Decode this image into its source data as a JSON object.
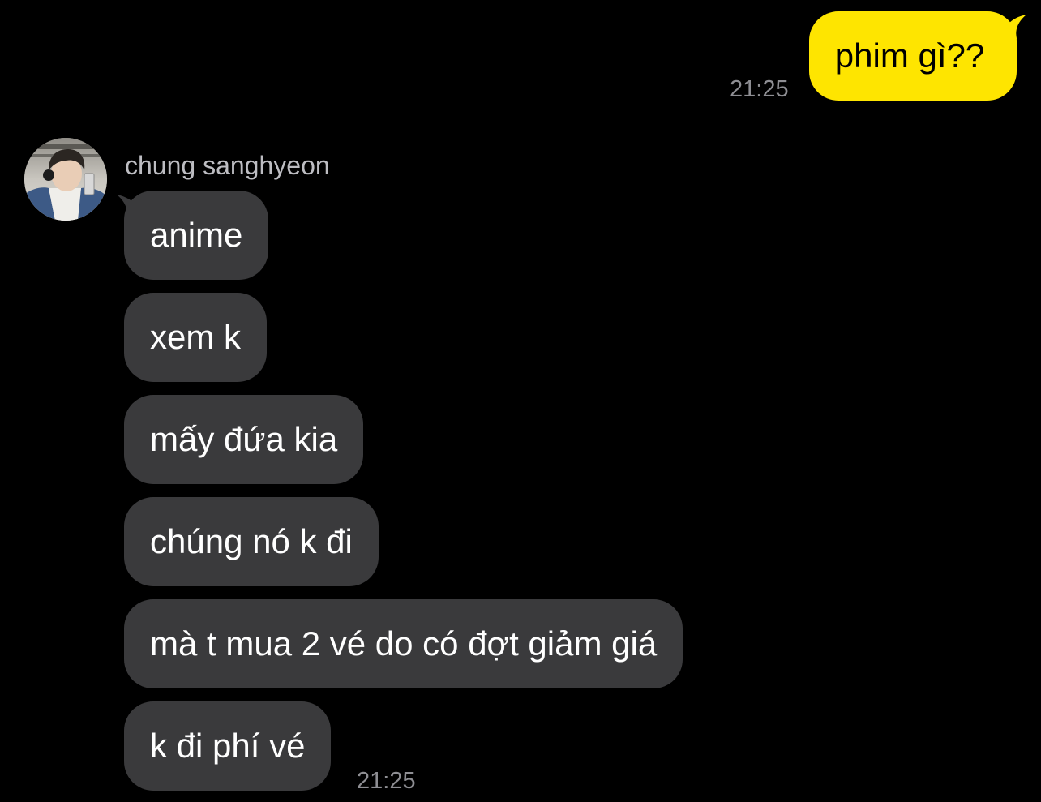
{
  "colors": {
    "background": "#000000",
    "sent_bubble": "#FEE500",
    "received_bubble": "#3A3A3C",
    "timestamp": "#8E8E93"
  },
  "sent": {
    "text": "phim gì??",
    "time": "21:25"
  },
  "received": {
    "sender_name": "chung sanghyeon",
    "avatar_icon": "profile-photo",
    "messages": [
      "anime",
      "xem k",
      "mấy đứa kia",
      "chúng nó k đi",
      "mà t mua 2 vé do có đợt giảm giá",
      "k đi phí vé"
    ],
    "time": "21:25"
  }
}
